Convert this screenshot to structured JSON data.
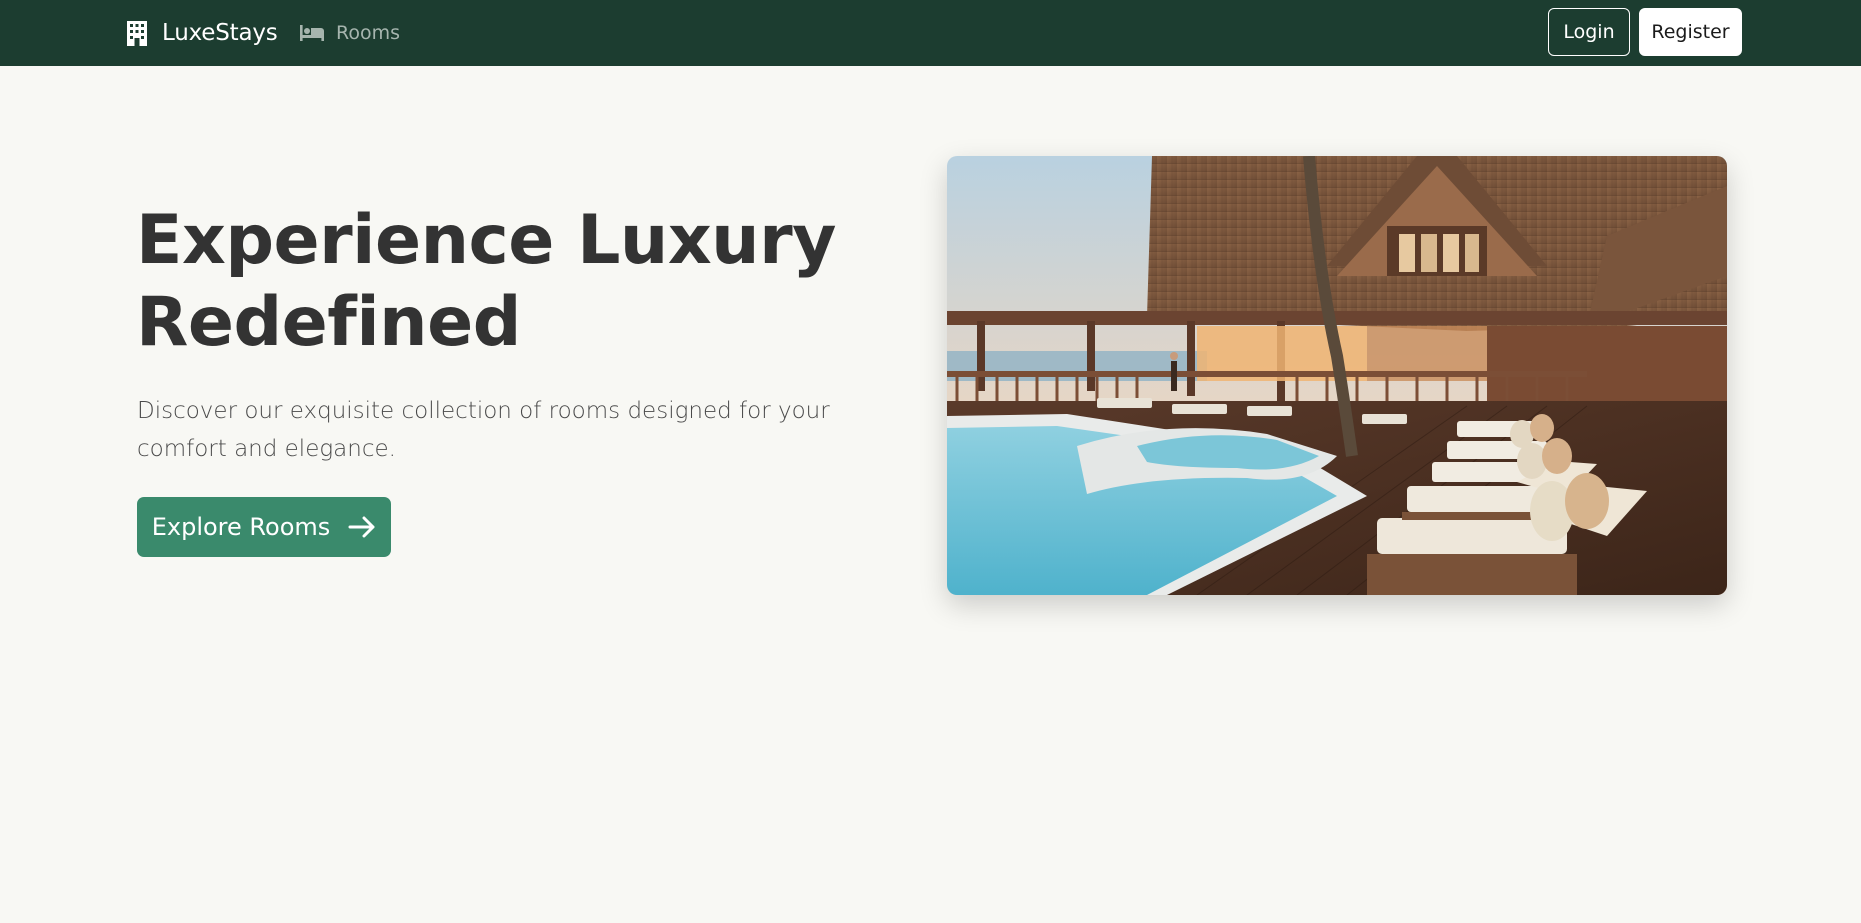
{
  "navbar": {
    "brand_text": "LuxeStays",
    "brand_icon": "hotel-building-icon",
    "rooms_label": "Rooms",
    "rooms_icon": "bed-icon",
    "login_label": "Login",
    "register_label": "Register",
    "background_color": "#1c3d30"
  },
  "hero": {
    "title_line1": "Experience Luxury",
    "title_line2": "Redefined",
    "subtitle": "Discover our exquisite collection of rooms designed for your comfort and elegance.",
    "cta_label": "Explore Rooms",
    "cta_icon": "arrow-right-icon",
    "cta_color": "#3a8a6c",
    "image_subject": "resort-pool-photo"
  }
}
